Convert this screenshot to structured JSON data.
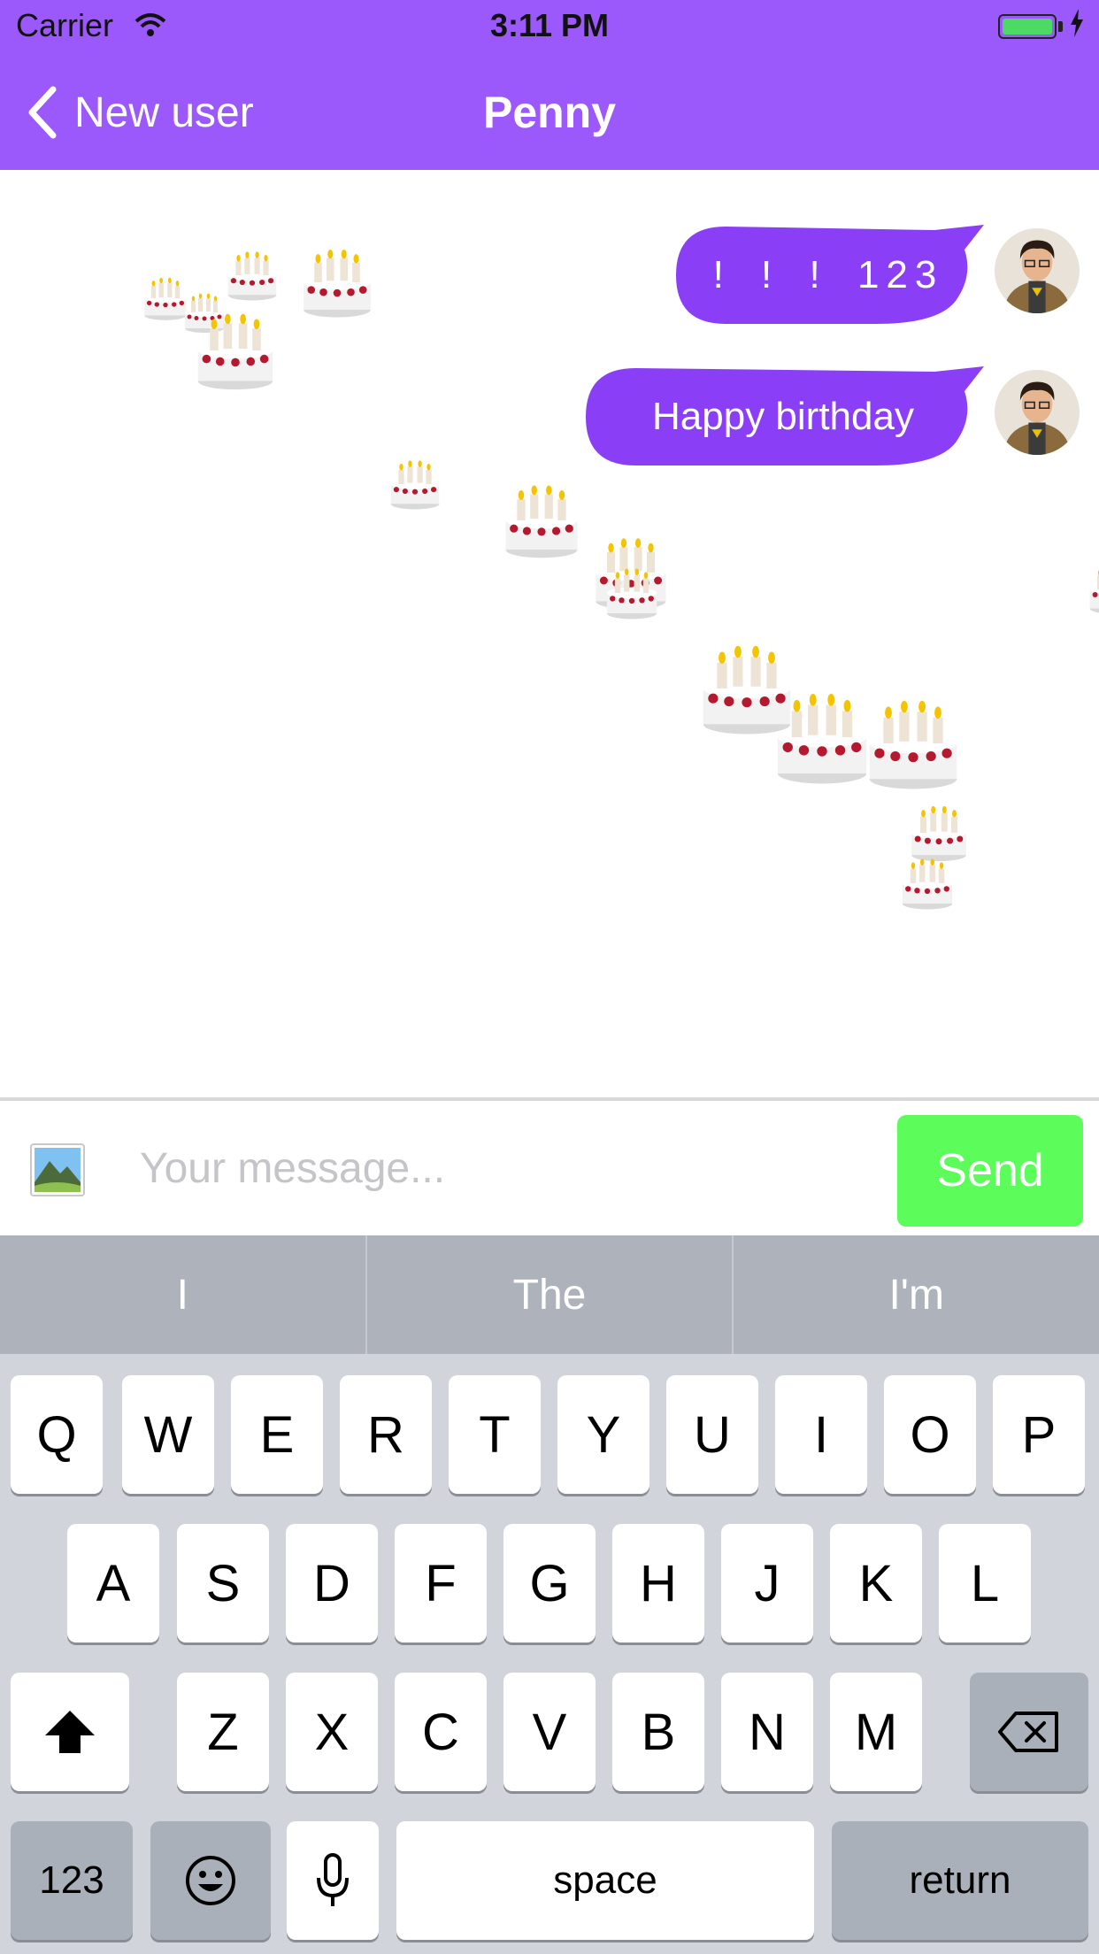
{
  "status_bar": {
    "carrier": "Carrier",
    "time": "3:11 PM"
  },
  "nav": {
    "back_label": "New user",
    "title": "Penny"
  },
  "messages": [
    {
      "text": "! ! ! 123",
      "icon": "sender-avatar"
    },
    {
      "text": "Happy birthday",
      "icon": "sender-avatar"
    }
  ],
  "decoration": {
    "icon": "birthday-cake-emoji"
  },
  "composer": {
    "placeholder": "Your message...",
    "send_label": "Send",
    "attach_icon": "photo-library-icon"
  },
  "keyboard": {
    "suggestions": [
      "I",
      "The",
      "I'm"
    ],
    "row1": [
      "Q",
      "W",
      "E",
      "R",
      "T",
      "Y",
      "U",
      "I",
      "O",
      "P"
    ],
    "row2": [
      "A",
      "S",
      "D",
      "F",
      "G",
      "H",
      "J",
      "K",
      "L"
    ],
    "row3": [
      "Z",
      "X",
      "C",
      "V",
      "B",
      "N",
      "M"
    ],
    "numbers_label": "123",
    "space_label": "space",
    "return_label": "return",
    "shift_icon": "shift-arrow-icon",
    "delete_icon": "delete-backspace-icon",
    "emoji_icon": "emoji-smiley-icon",
    "mic_icon": "microphone-icon"
  },
  "colors": {
    "brand": "#9b59fb",
    "bubble": "#8a3ff6",
    "send": "#5cfc5a",
    "keyboard_bg": "#d1d4da"
  }
}
